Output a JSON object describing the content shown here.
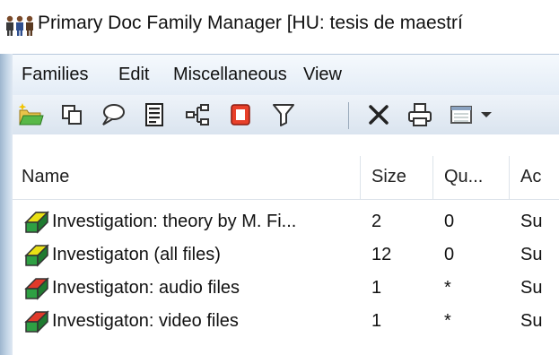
{
  "window": {
    "title": "Primary Doc Family Manager [HU: tesis de maestrí",
    "icon": "people-icon"
  },
  "menu": {
    "items": [
      "Families",
      "Edit",
      "Miscellaneous",
      "View"
    ]
  },
  "toolbar": {
    "buttons": [
      {
        "name": "new-family-icon"
      },
      {
        "name": "copy-icon"
      },
      {
        "name": "comment-icon"
      },
      {
        "name": "properties-icon"
      },
      {
        "name": "tree-icon"
      },
      {
        "name": "color-square-icon"
      },
      {
        "name": "filter-icon"
      },
      {
        "name": "delete-icon"
      },
      {
        "name": "print-icon"
      },
      {
        "name": "view-options-icon"
      }
    ]
  },
  "table": {
    "columns": [
      "Name",
      "Size",
      "Qu...",
      "Ac"
    ],
    "rows": [
      {
        "name": "Investigation: theory by M. Fi...",
        "size": "2",
        "qu": "0",
        "ac": "Su",
        "color": "#e9e015"
      },
      {
        "name": "Investigaton (all files)",
        "size": "12",
        "qu": "0",
        "ac": "Su",
        "color": "#e9e015"
      },
      {
        "name": "Investigaton: audio files",
        "size": "1",
        "qu": "*",
        "ac": "Su",
        "color": "#e03a2a"
      },
      {
        "name": "Investigaton: video files",
        "size": "1",
        "qu": "*",
        "ac": "Su",
        "color": "#e03a2a"
      }
    ]
  }
}
